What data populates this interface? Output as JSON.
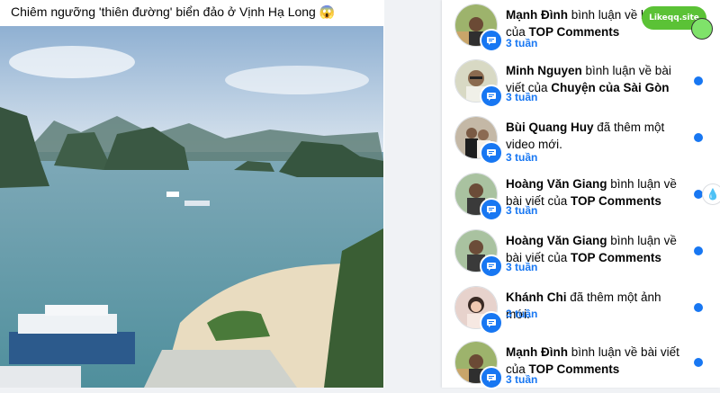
{
  "post": {
    "caption": "Chiêm ngưỡng 'thiên đường' biển đảo ở Vịnh Hạ Long 😱"
  },
  "brand": {
    "label": "Likeqq.site"
  },
  "notifications": [
    {
      "name": "Mạnh Đình",
      "action": " bình luận về bài viết của ",
      "target": "TOP Comments",
      "time": "3 tuần",
      "unread": true
    },
    {
      "name": "Minh Nguyen",
      "action": " bình luận về bài viết của ",
      "target": "Chuyện của Sài Gòn",
      "time": "3 tuần",
      "unread": true
    },
    {
      "name": "Bùi Quang Huy",
      "action": " đã thêm một video mới.",
      "target": "",
      "time": "3 tuần",
      "unread": true
    },
    {
      "name": "Hoàng Văn Giang",
      "action": " bình luận về bài viết của ",
      "target": "TOP Comments",
      "time": "3 tuần",
      "unread": true
    },
    {
      "name": "Hoàng Văn Giang",
      "action": " bình luận về bài viết của ",
      "target": "TOP Comments",
      "time": "3 tuần",
      "unread": true
    },
    {
      "name": "Khánh Chi",
      "action": " đã thêm một ảnh mới.",
      "target": "",
      "time": "3 tuần",
      "unread": true
    },
    {
      "name": "Mạnh Đình",
      "action": " bình luận về bài viết của ",
      "target": "TOP Comments",
      "time": "3 tuần",
      "unread": true
    }
  ],
  "colors": {
    "accent": "#1877f2",
    "brand": "#5bc236"
  }
}
